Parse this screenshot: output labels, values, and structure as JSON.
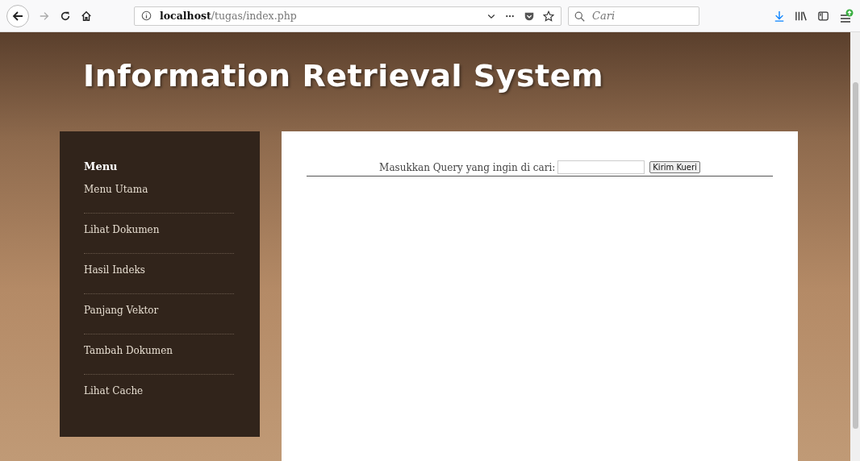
{
  "browser": {
    "url_host": "localhost",
    "url_path": "/tugas/index.php",
    "search_placeholder": "Cari"
  },
  "site_title": "Information Retrieval System",
  "sidebar": {
    "heading": "Menu",
    "items": [
      {
        "label": "Menu Utama"
      },
      {
        "label": "Lihat Dokumen"
      },
      {
        "label": "Hasil Indeks"
      },
      {
        "label": "Panjang Vektor"
      },
      {
        "label": "Tambah Dokumen"
      },
      {
        "label": "Lihat Cache"
      }
    ]
  },
  "query_form": {
    "label": "Masukkan Query yang ingin di cari:",
    "button": "Kirim Kueri"
  }
}
